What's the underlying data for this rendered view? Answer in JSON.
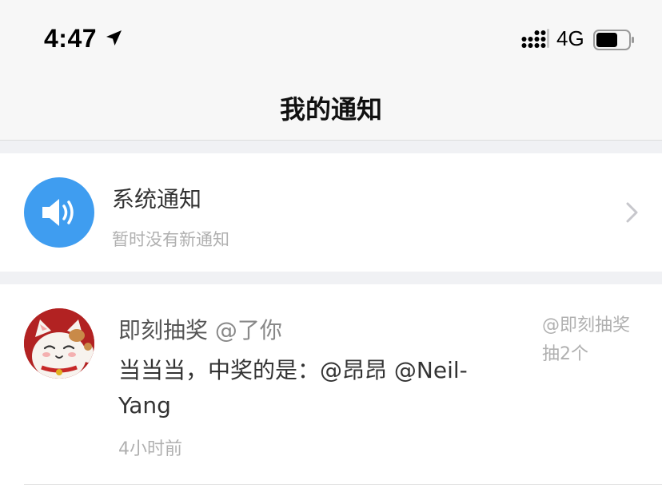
{
  "status_bar": {
    "time": "4:47",
    "network": "4G"
  },
  "nav": {
    "title": "我的通知"
  },
  "system_notice": {
    "title": "系统通知",
    "subtitle": "暂时没有新通知",
    "icon": "speaker-icon",
    "avatar_color": "#3f9df0"
  },
  "notification": {
    "sender": "即刻抽奖",
    "action": "@了你",
    "message": "当当当，中奖的是：@昂昂 @Neil-Yang",
    "time_ago": "4小时前",
    "side_text": "@即刻抽奖 抽2个"
  }
}
